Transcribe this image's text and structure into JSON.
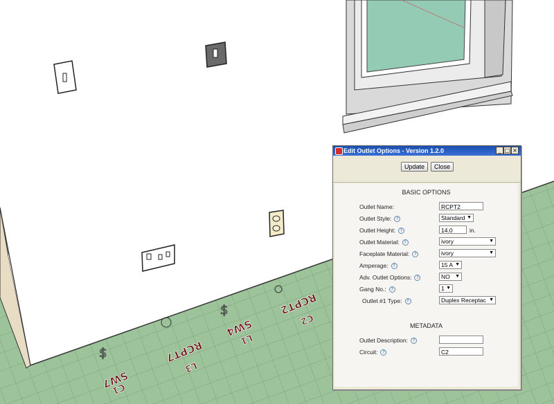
{
  "scene": {
    "annotations": [
      "SW7",
      "C1",
      "RCPT7",
      "L3",
      "SW4",
      "L1",
      "RCPT2",
      "C2"
    ],
    "colors": {
      "floor": "#9cc39a",
      "grid": "#7fa37e",
      "wall": "#ffffff",
      "glass": "#93cbb5",
      "annotation": "#6b1a1a"
    }
  },
  "dialog": {
    "title": "Edit Outlet Options - Version 1.2.0",
    "window_buttons": {
      "minimize": "_",
      "maximize": "□",
      "close": "×"
    },
    "buttons": {
      "update": "Update",
      "close": "Close"
    },
    "basic_section": "BASIC OPTIONS",
    "help_glyph": "?",
    "fields": {
      "outlet_name": {
        "label": "Outlet Name:",
        "value": "RCPT2"
      },
      "outlet_style": {
        "label": "Outlet Style:",
        "value": "Standard"
      },
      "outlet_height": {
        "label": "Outlet Height:",
        "value": "14.0",
        "unit": "in."
      },
      "outlet_material": {
        "label": "Outlet Material:",
        "value": "ivory"
      },
      "faceplate_material": {
        "label": "Faceplate Material:",
        "value": "ivory"
      },
      "amperage": {
        "label": "Amperage:",
        "value": "15 A"
      },
      "adv_outlet_options": {
        "label": "Adv. Outlet Options:",
        "value": "NO"
      },
      "gang_no": {
        "label": "Gang No.:",
        "value": "1"
      },
      "outlet1_type": {
        "label": "Outlet #1 Type:",
        "value": "Duplex Receptac"
      }
    },
    "metadata_section": "METADATA",
    "metadata": {
      "outlet_description": {
        "label": "Outlet Description:",
        "value": ""
      },
      "circuit": {
        "label": "Circuit:",
        "value": "C2"
      }
    }
  }
}
